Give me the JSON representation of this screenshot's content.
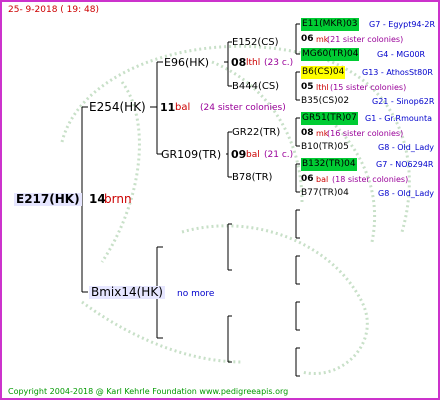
{
  "header": {
    "date": "25-  9-2018 ( 19: 48)"
  },
  "footer": {
    "copyright": "Copyright 2004-2018 @ Karl Kehrle Foundation    www.pedigreeapis.org"
  },
  "colors": {
    "border": "#cc33cc",
    "green_box": "#00cc33",
    "yellow_box": "#ffff00",
    "red": "#cc0000",
    "blue": "#0000cc",
    "purple": "#990099",
    "footer_green": "#009900"
  },
  "pedigree": {
    "root": {
      "name": "E217(HK)",
      "year": "14",
      "code": "brnn"
    },
    "sire": {
      "name": "E254(HK)",
      "year": "11",
      "code": "bal",
      "note": "(24 sister colonies)"
    },
    "dam": {
      "name": "Bmix14(HK)",
      "note": "no more"
    },
    "ss": {
      "name": "E96(HK)",
      "year": "08",
      "code": "lthl",
      "note": "(23 c.)"
    },
    "sd": {
      "name": "GR109(TR)",
      "year": "09",
      "code": "bal",
      "note": "(21 c.)"
    },
    "sss": {
      "name": "E152(CS)"
    },
    "ssd": {
      "name": "B444(CS)"
    },
    "sds": {
      "name": "GR22(TR)"
    },
    "sdd": {
      "name": "B78(TR)"
    },
    "g1": {
      "name": "E11(MKR)03",
      "gen": "G7 - Egypt94-2R",
      "year": "06",
      "code": "mk",
      "note": "(21 sister colonies)",
      "dam": "MG60(TR)04",
      "damgen": "G4 - MG00R"
    },
    "g2": {
      "name": "B6(CS)04",
      "gen": "G13 - AthosSt80R",
      "year": "05",
      "code": "lthl",
      "note": "(15 sister colonies)",
      "dam": "B35(CS)02",
      "damgen": "G21 - Sinop62R"
    },
    "g3": {
      "name": "GR51(TR)07",
      "gen": "G1 - Gr.Rmounta",
      "year": "08",
      "code": "mk",
      "note": "(16 sister colonies)",
      "dam": "B10(TR)05",
      "damgen": "G8 - Old_Lady"
    },
    "g4": {
      "name": "B132(TR)04",
      "gen": "G7 - NO6294R",
      "year": "06",
      "code": "bal",
      "note": "(18 sister colonies)",
      "dam": "B77(TR)04",
      "damgen": "G8 - Old_Lady"
    }
  }
}
